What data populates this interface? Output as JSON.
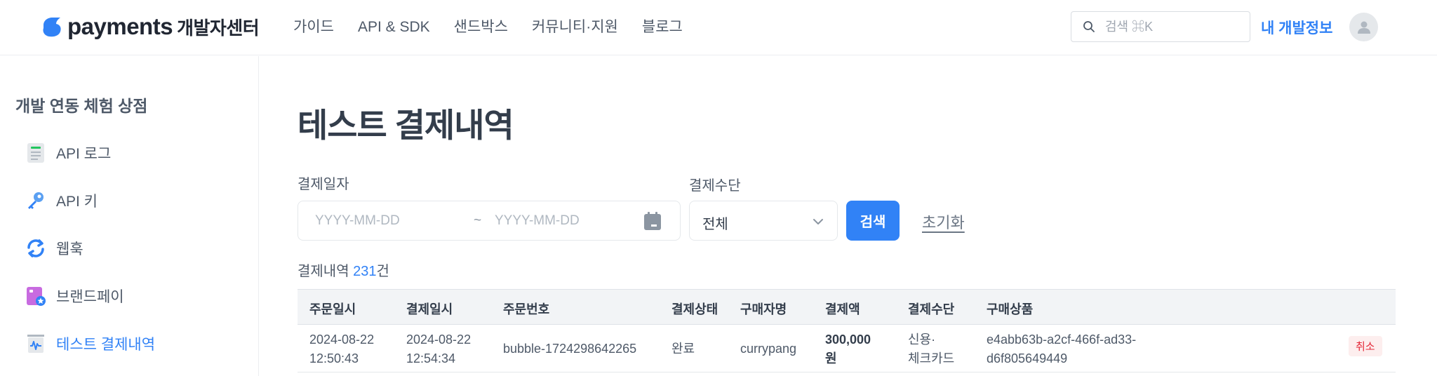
{
  "header": {
    "logo_text": "payments",
    "logo_sub": "개발자센터",
    "nav": [
      "가이드",
      "API & SDK",
      "샌드박스",
      "커뮤니티·지원",
      "블로그"
    ],
    "search_placeholder": "검색 ⌘K",
    "my_info": "내 개발정보"
  },
  "sidebar": {
    "title": "개발 연동 체험 상점",
    "items": [
      {
        "label": "API 로그",
        "icon": "log-icon"
      },
      {
        "label": "API 키",
        "icon": "key-icon"
      },
      {
        "label": "웹훅",
        "icon": "refresh-icon"
      },
      {
        "label": "브랜드페이",
        "icon": "brandpay-icon"
      },
      {
        "label": "테스트 결제내역",
        "icon": "payment-history-icon",
        "active": true
      }
    ]
  },
  "main": {
    "title": "테스트 결제내역",
    "date_label": "결제일자",
    "date_start_placeholder": "YYYY-MM-DD",
    "date_sep": "~",
    "date_end_placeholder": "YYYY-MM-DD",
    "method_label": "결제수단",
    "method_value": "전체",
    "search_button": "검색",
    "reset_button": "초기화",
    "count_prefix": "결제내역 ",
    "count_value": "231",
    "count_suffix": "건"
  },
  "table": {
    "headers": [
      "주문일시",
      "결제일시",
      "주문번호",
      "결제상태",
      "구매자명",
      "결제액",
      "결제수단",
      "구매상품"
    ],
    "rows": [
      {
        "order_date": "2024-08-22",
        "order_time": "12:50:43",
        "pay_date": "2024-08-22",
        "pay_time": "12:54:34",
        "order_no": "bubble-1724298642265",
        "status": "완료",
        "buyer": "currypang",
        "amount": "300,000",
        "amount_unit": "원",
        "method_line1": "신용·",
        "method_line2": "체크카드",
        "product_line1": "e4abb63b-a2cf-466f-ad33-",
        "product_line2": "d6f805649449",
        "action": "취소"
      }
    ]
  },
  "colors": {
    "accent": "#3182f6",
    "cancel_bg": "#fdeeee",
    "cancel_text": "#e42939"
  }
}
